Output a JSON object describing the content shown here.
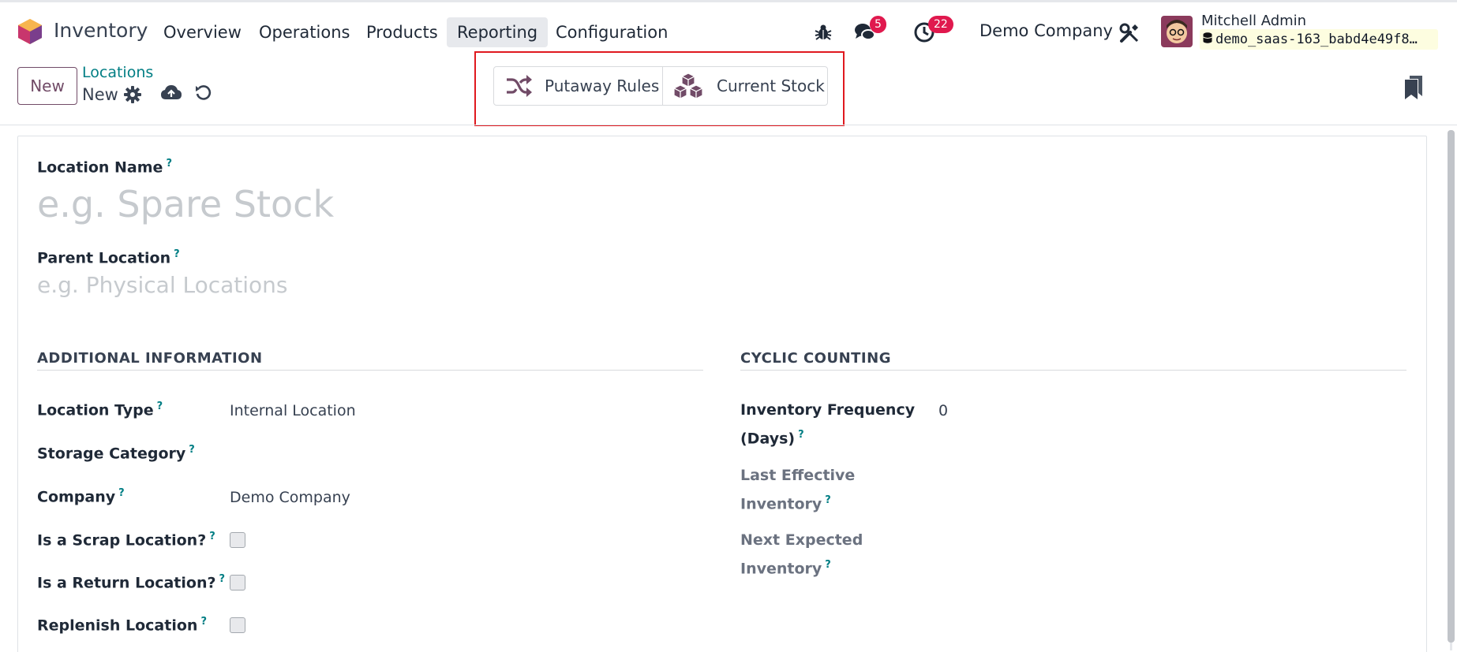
{
  "app": {
    "name": "Inventory"
  },
  "menu": [
    {
      "label": "Overview",
      "active": false
    },
    {
      "label": "Operations",
      "active": false
    },
    {
      "label": "Products",
      "active": false
    },
    {
      "label": "Reporting",
      "active": true
    },
    {
      "label": "Configuration",
      "active": false
    }
  ],
  "systray": {
    "messages_count": "5",
    "activities_count": "22",
    "company": "Demo Company",
    "user_name": "Mitchell Admin",
    "db_name": "demo_saas-163_babd4e49f8…"
  },
  "control_panel": {
    "new_label": "New",
    "breadcrumb_parent": "Locations",
    "breadcrumb_current": "New"
  },
  "smart_buttons": {
    "putaway_rules": "Putaway Rules",
    "current_stock": "Current Stock"
  },
  "form": {
    "location_name_label": "Location Name",
    "location_name_placeholder": "e.g. Spare Stock",
    "parent_location_label": "Parent Location",
    "parent_location_placeholder": "e.g. Physical Locations",
    "help_mark": "?",
    "additional_info": {
      "title": "ADDITIONAL INFORMATION",
      "location_type_label": "Location Type",
      "location_type_value": "Internal Location",
      "storage_category_label": "Storage Category",
      "company_label": "Company",
      "company_value": "Demo Company",
      "scrap_label": "Is a Scrap Location?",
      "return_label": "Is a Return Location?",
      "replenish_label": "Replenish Location"
    },
    "cyclic_counting": {
      "title": "CYCLIC COUNTING",
      "frequency_label_1": "Inventory Frequency",
      "frequency_label_2": "(Days)",
      "frequency_value": "0",
      "last_effective_1": "Last Effective",
      "last_effective_2": "Inventory",
      "next_expected_1": "Next Expected",
      "next_expected_2": "Inventory"
    }
  },
  "colors": {
    "brand": "#714b67",
    "link": "#017e84",
    "badge": "#e0194e",
    "highlight": "#e0191f"
  }
}
